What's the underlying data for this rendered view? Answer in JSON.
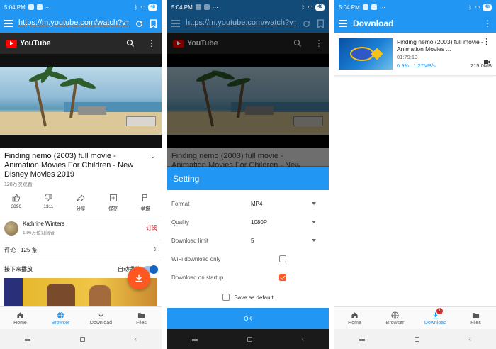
{
  "status": {
    "time": "5:04 PM",
    "battery": "48"
  },
  "browser": {
    "url": "https://m.youtube.com/watch?v=",
    "youtube_brand": "YouTube",
    "video_title": "Finding nemo (2003) full movie - Animation Movies For Children - New Disney Movies 2019",
    "views": "128万次观看",
    "actions": [
      {
        "icon": "thumbs-up-icon",
        "label": "3896"
      },
      {
        "icon": "thumbs-down-icon",
        "label": "1311"
      },
      {
        "icon": "share-icon",
        "label": "分享"
      },
      {
        "icon": "add-to-playlist-icon",
        "label": "保存"
      },
      {
        "icon": "flag-icon",
        "label": "举报"
      }
    ],
    "channel_name": "Kathrine Winters",
    "channel_subs": "1.96万位订阅者",
    "subscribe_label": "订阅",
    "comments_label": "评论 · 125 条",
    "up_next_label": "接下来播放",
    "autoplay_label": "自动播放"
  },
  "bottom_nav": {
    "items": [
      {
        "icon": "home-icon",
        "label": "Home"
      },
      {
        "icon": "globe-icon",
        "label": "Browser"
      },
      {
        "icon": "download-icon",
        "label": "Download"
      },
      {
        "icon": "folder-icon",
        "label": "Files"
      }
    ],
    "download_badge": "1"
  },
  "settings": {
    "title": "Setting",
    "rows": [
      {
        "label": "Format",
        "value": "MP4"
      },
      {
        "label": "Quality",
        "value": "1080P"
      },
      {
        "label": "Download limit",
        "value": "5"
      }
    ],
    "wifi_label": "WiFi download only",
    "wifi_checked": false,
    "startup_label": "Download on startup",
    "startup_checked": true,
    "save_default_label": "Save as default",
    "ok_label": "OK"
  },
  "downloads": {
    "title": "Download",
    "items": [
      {
        "name": "Finding nemo (2003) full movie - Animation Movies ...",
        "duration": "01:79:19",
        "progress": "0.9%",
        "speed": "1.27MB/s",
        "size": "215.0MB"
      }
    ]
  },
  "colors": {
    "primary": "#2196f3",
    "accent": "#ff5722",
    "youtube_red": "#ff0000",
    "subscribe_red": "#cc0000"
  }
}
